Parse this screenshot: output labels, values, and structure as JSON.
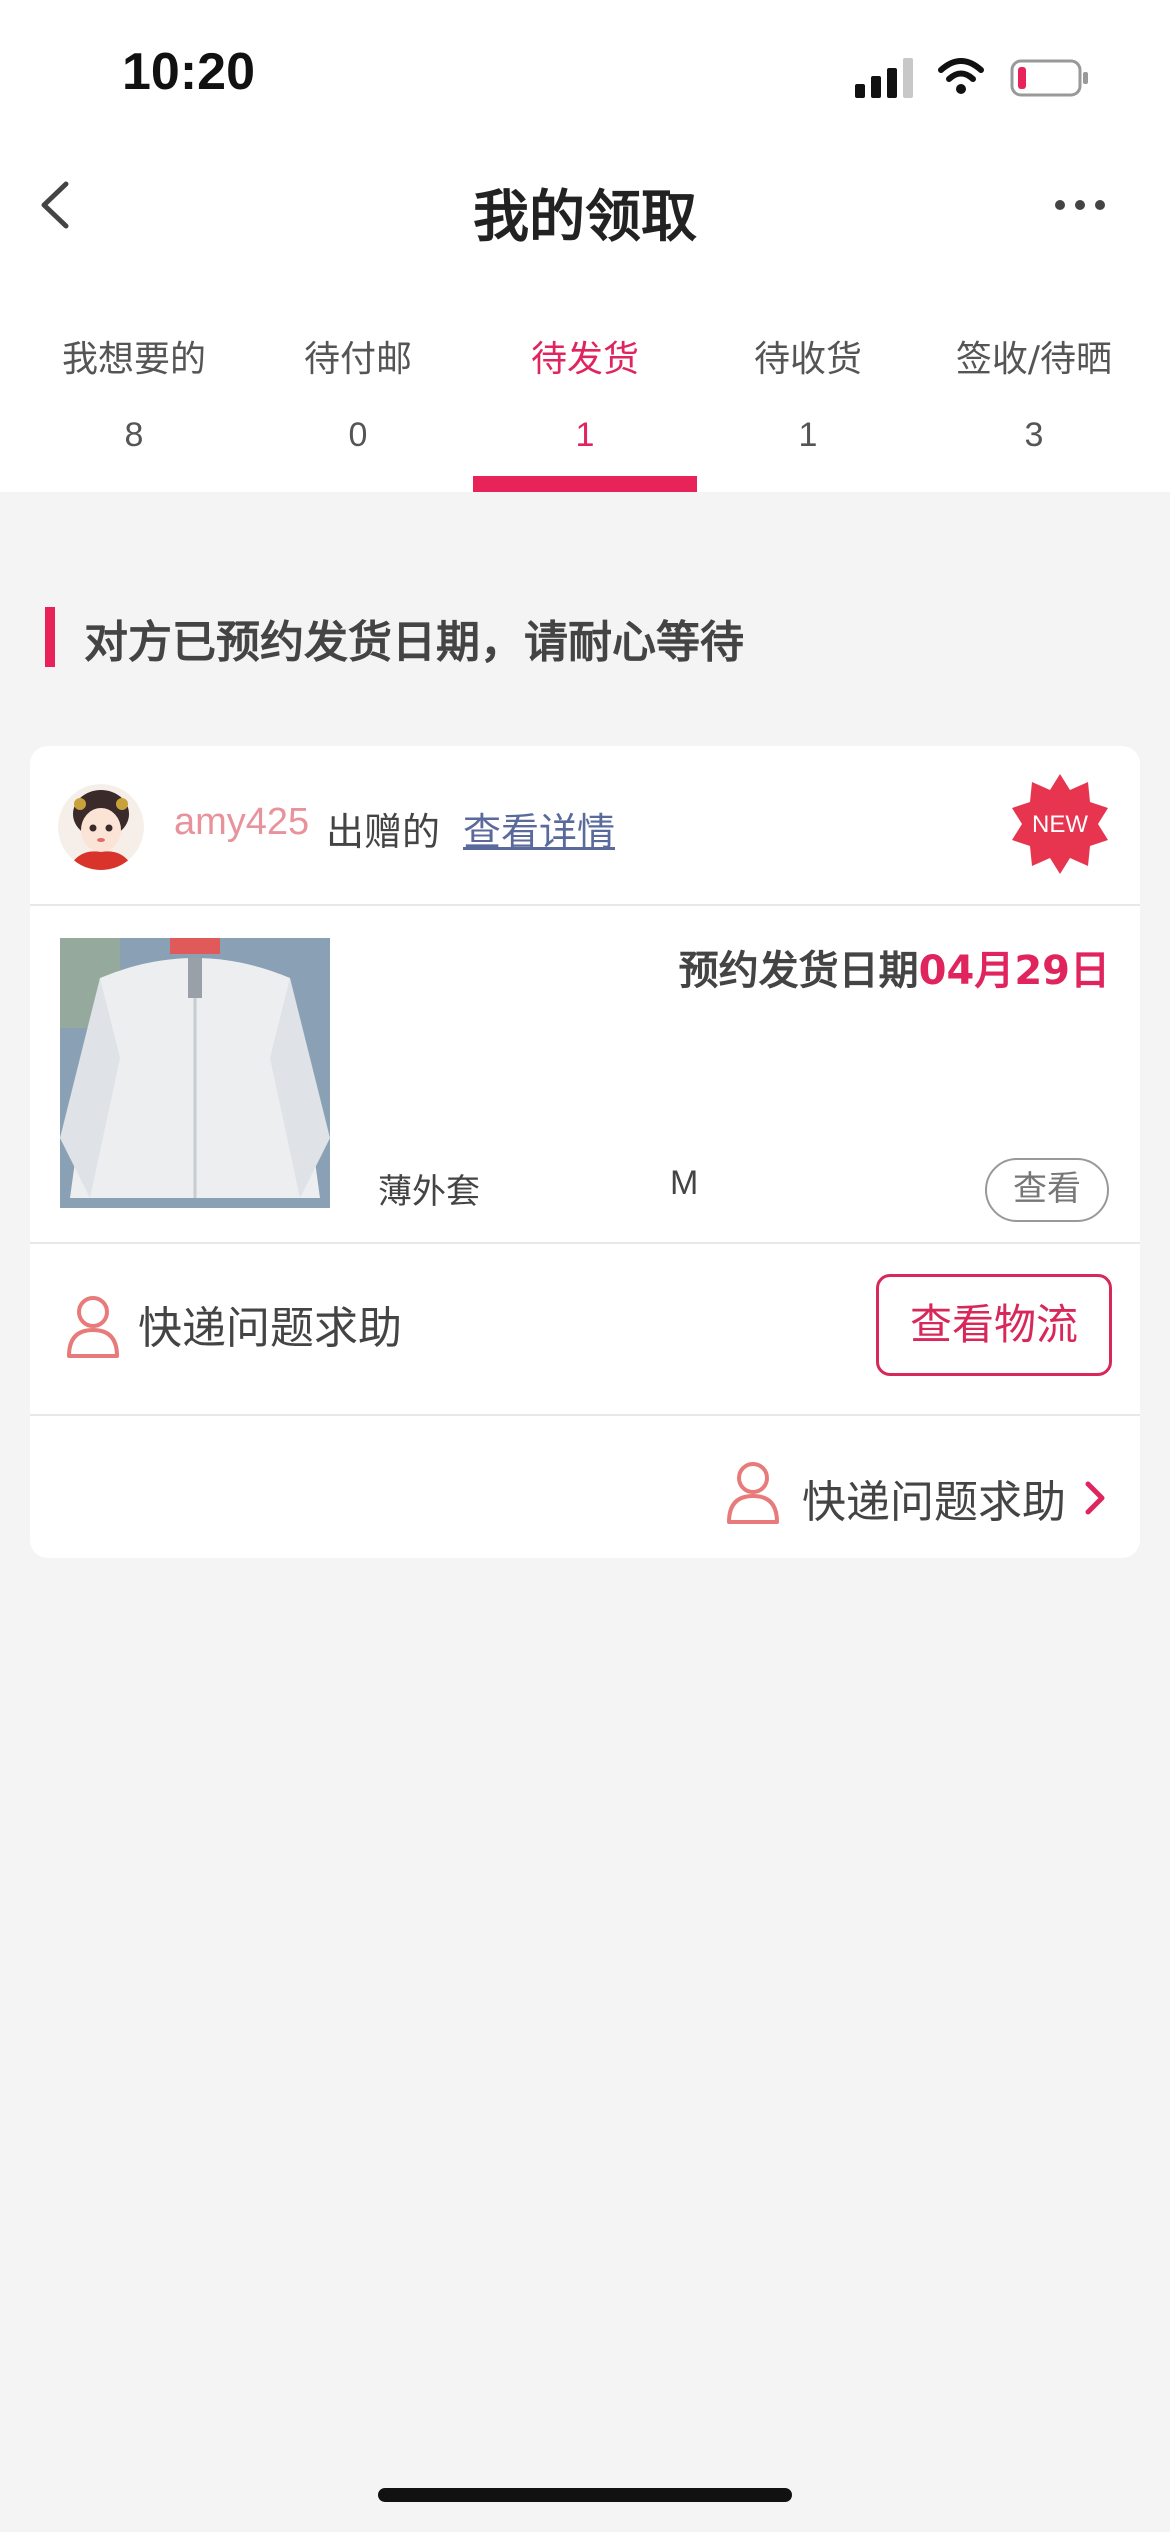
{
  "status_bar": {
    "time": "10:20",
    "icons": [
      "signal-icon",
      "wifi-icon",
      "battery-icon"
    ],
    "battery_color": "#e8235a"
  },
  "nav": {
    "title": "我的领取",
    "back_icon": "chevron-left-icon",
    "more_icon": "more-dots-icon"
  },
  "tabs": [
    {
      "label": "我想要的",
      "count": "8",
      "active": false
    },
    {
      "label": "待付邮",
      "count": "0",
      "active": false
    },
    {
      "label": "待发货",
      "count": "1",
      "active": true
    },
    {
      "label": "待收货",
      "count": "1",
      "active": false
    },
    {
      "label": "签收/待晒",
      "count": "3",
      "active": false
    }
  ],
  "notice": "对方已预约发货日期，请耐心等待",
  "card": {
    "giver_name": "amy425",
    "giver_suffix": "出赠的",
    "details_link": "查看详情",
    "new_badge": "NEW",
    "item": {
      "ship_date_label": "预约发货日期",
      "ship_date_value": "04月29日",
      "name": "薄外套",
      "size": "M",
      "view_label": "查看"
    },
    "help_label": "快递问题求助",
    "logistics_label": "查看物流",
    "help_label_bottom": "快递问题求助"
  },
  "colors": {
    "accent": "#e8235a",
    "giver_name": "#e8939c",
    "link": "#5a6a9b",
    "background": "#f4f4f4"
  }
}
